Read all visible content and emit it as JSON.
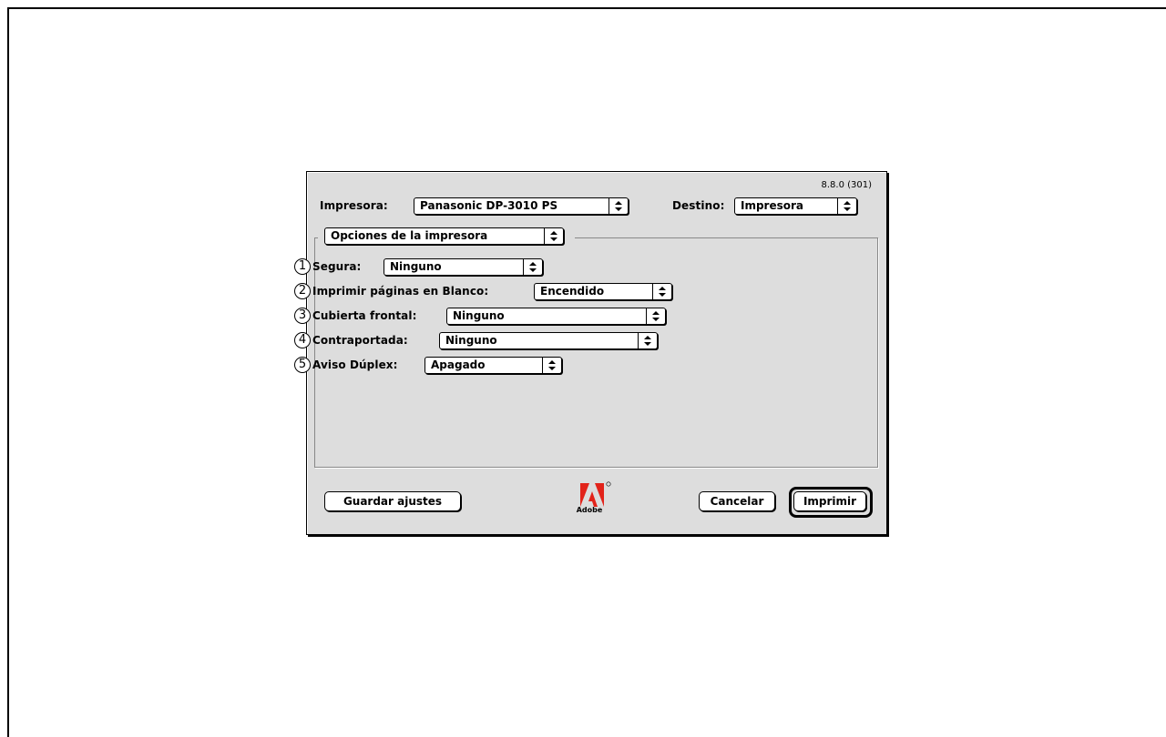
{
  "dialog": {
    "version": "8.8.0 (301)",
    "printer_label": "Impresora:",
    "printer_value": "Panasonic DP-3010 PS",
    "destination_label": "Destino:",
    "destination_value": "Impresora",
    "panel_value": "Opciones de la impresora",
    "options": [
      {
        "number": "1",
        "label": "Segura:",
        "value": "Ninguno"
      },
      {
        "number": "2",
        "label": "Imprimir páginas en Blanco:",
        "value": "Encendido"
      },
      {
        "number": "3",
        "label": "Cubierta frontal:",
        "value": "Ninguno"
      },
      {
        "number": "4",
        "label": "Contraportada:",
        "value": "Ninguno"
      },
      {
        "number": "5",
        "label": "Aviso Dúplex:",
        "value": "Apagado"
      }
    ],
    "save_label": "Guardar ajustes",
    "cancel_label": "Cancelar",
    "print_label": "Imprimir",
    "logo_text": "Adobe",
    "arrow_glyph": "⬍",
    "colors": {
      "dialog_bg": "#dddddd",
      "logo_red": "#e2231a"
    }
  }
}
